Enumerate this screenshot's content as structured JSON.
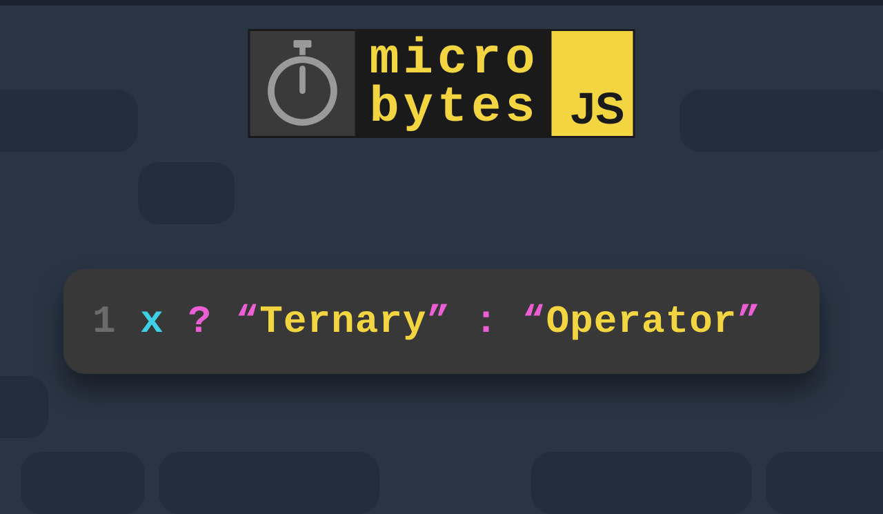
{
  "brand": {
    "line1": "micro",
    "line2": "bytes",
    "badge": "JS"
  },
  "code": {
    "lineNumber": "1",
    "tokens": {
      "var": "x",
      "question": "?",
      "openQuote1": "“",
      "string1": "Ternary",
      "closeQuote1": "”",
      "colon": ":",
      "openQuote2": "“",
      "string2": "Operator",
      "closeQuote2": "”"
    }
  }
}
